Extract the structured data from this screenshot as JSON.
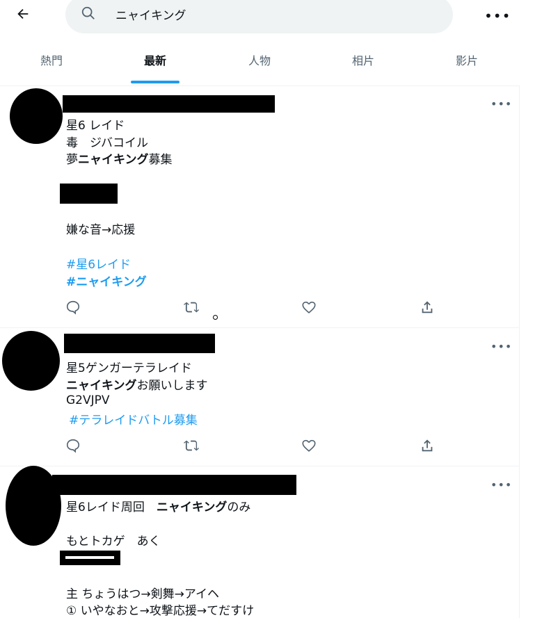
{
  "search": {
    "query": "ニャイキング"
  },
  "tabs": [
    {
      "label": "熱門"
    },
    {
      "label": "最新"
    },
    {
      "label": "人物"
    },
    {
      "label": "相片"
    },
    {
      "label": "影片"
    }
  ],
  "tweets": [
    {
      "lines": [
        "星6 レイド",
        "毒　ジバコイル",
        "夢",
        "ニャイキング",
        "募集",
        "嫌な音→応援"
      ],
      "hashtags": [
        "#星6レイド",
        "#ニャイキング"
      ]
    },
    {
      "lines": [
        "星5ゲンガーテラレイド",
        "ニャイキング",
        "お願いします",
        "G2VJPV"
      ],
      "hashtags": [
        "#テラレイドバトル募集"
      ]
    },
    {
      "lines": [
        "星6レイド周回　",
        "ニャイキング",
        "のみ",
        "もとトカゲ　あく",
        "主 ちょうはつ→剣舞→アイヘ",
        "① いやなおと→攻撃応援→てだすけ"
      ]
    }
  ],
  "icons": [
    "back-arrow-icon",
    "search-icon",
    "more-icon",
    "reply-icon",
    "retweet-icon",
    "like-icon",
    "share-icon"
  ]
}
